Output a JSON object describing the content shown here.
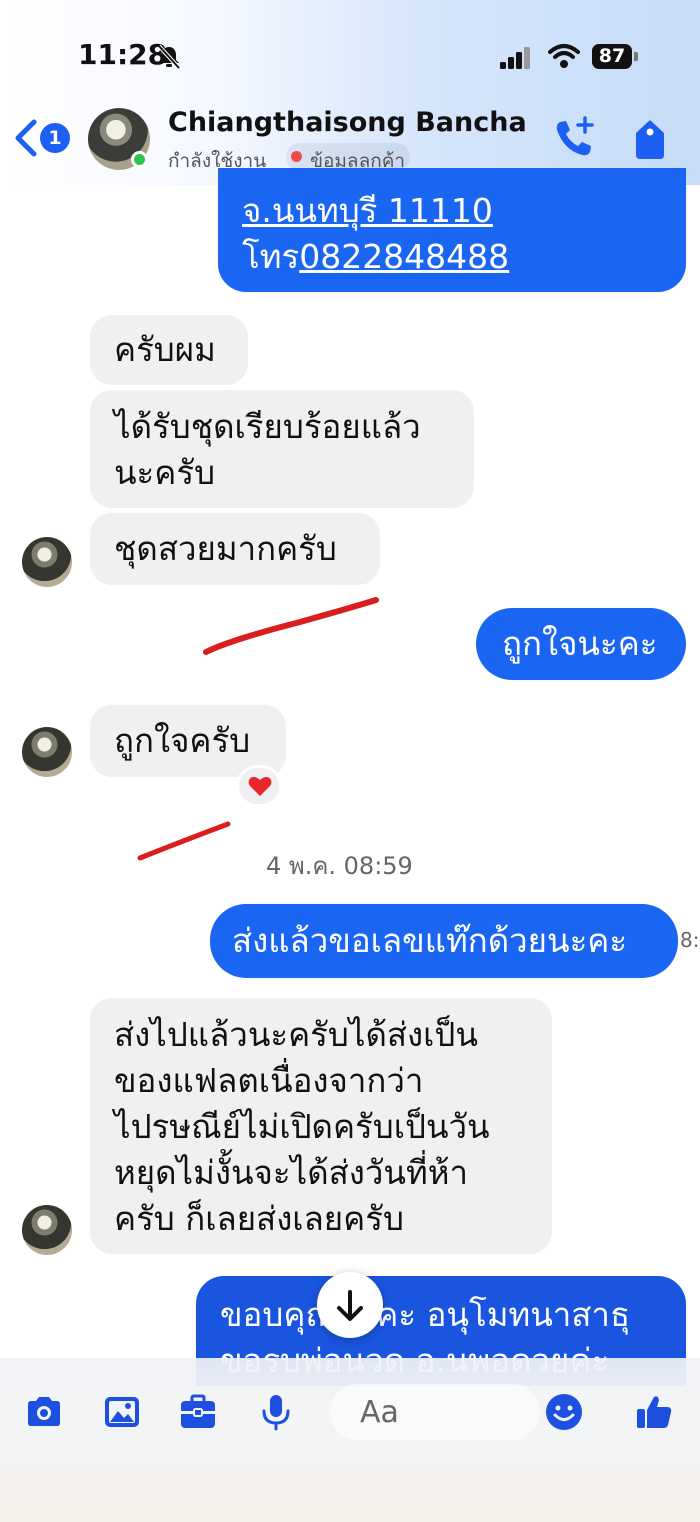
{
  "status_bar": {
    "time": "11:28",
    "battery": "87"
  },
  "header": {
    "back_badge": "1",
    "contact_name": "Chiangthaisong Bancha",
    "status": "กำลังใช้งาน",
    "info_label": "ข้อมูลลูกค้า"
  },
  "messages": {
    "m0_line1": "จ.นนทบุรี 11110",
    "m0_line2_prefix": "โทร",
    "m0_line2_phone": "0822848488",
    "m1": "ครับผม",
    "m2_line1": "ได้รับชุดเรียบร้อยแล้ว",
    "m2_line2": "นะครับ",
    "m3": "ชุดสวยมากครับ",
    "m4": "ถูกใจนะคะ",
    "m5": "ถูกใจครับ",
    "m5_reaction": "heart",
    "timestamp": "4 พ.ค. 08:59",
    "m6": "ส่งแล้วขอเลขแท๊กด้วยนะคะ",
    "m6_side_time": "8:",
    "m7_line1": "ส่งไปแล้วนะครับได้ส่งเป็น",
    "m7_line2": "ของแฟลตเนื่องจากว่า",
    "m7_line3": "ไปรษณีย์ไม่เปิดครับเป็นวัน",
    "m7_line4": "หยุดไม่งั้นจะได้ส่งวันที่ห้า",
    "m7_line5": "ครับ ก็เลยส่งเลยครับ",
    "m8_line1": "ขอบคุณนะคะ อนุโมทนาสาธุ",
    "m8_line2": "ขอรบพ่อนวด อ.นพอดวยค่ะ"
  },
  "composer": {
    "placeholder": "Aa"
  },
  "icons": {
    "status": [
      "bell-slash-icon",
      "signal-icon",
      "wifi-icon"
    ],
    "header": [
      "back-icon",
      "call-plus-icon",
      "tag-icon"
    ],
    "toolbar": [
      "camera-icon",
      "gallery-icon",
      "briefcase-icon",
      "microphone-icon",
      "emoji-icon",
      "thumbs-up-icon"
    ]
  },
  "colors": {
    "accent": "#1a66f2",
    "incoming_bubble": "#f0f0f2",
    "online": "#31c24d",
    "annotation": "#d81e1e"
  }
}
